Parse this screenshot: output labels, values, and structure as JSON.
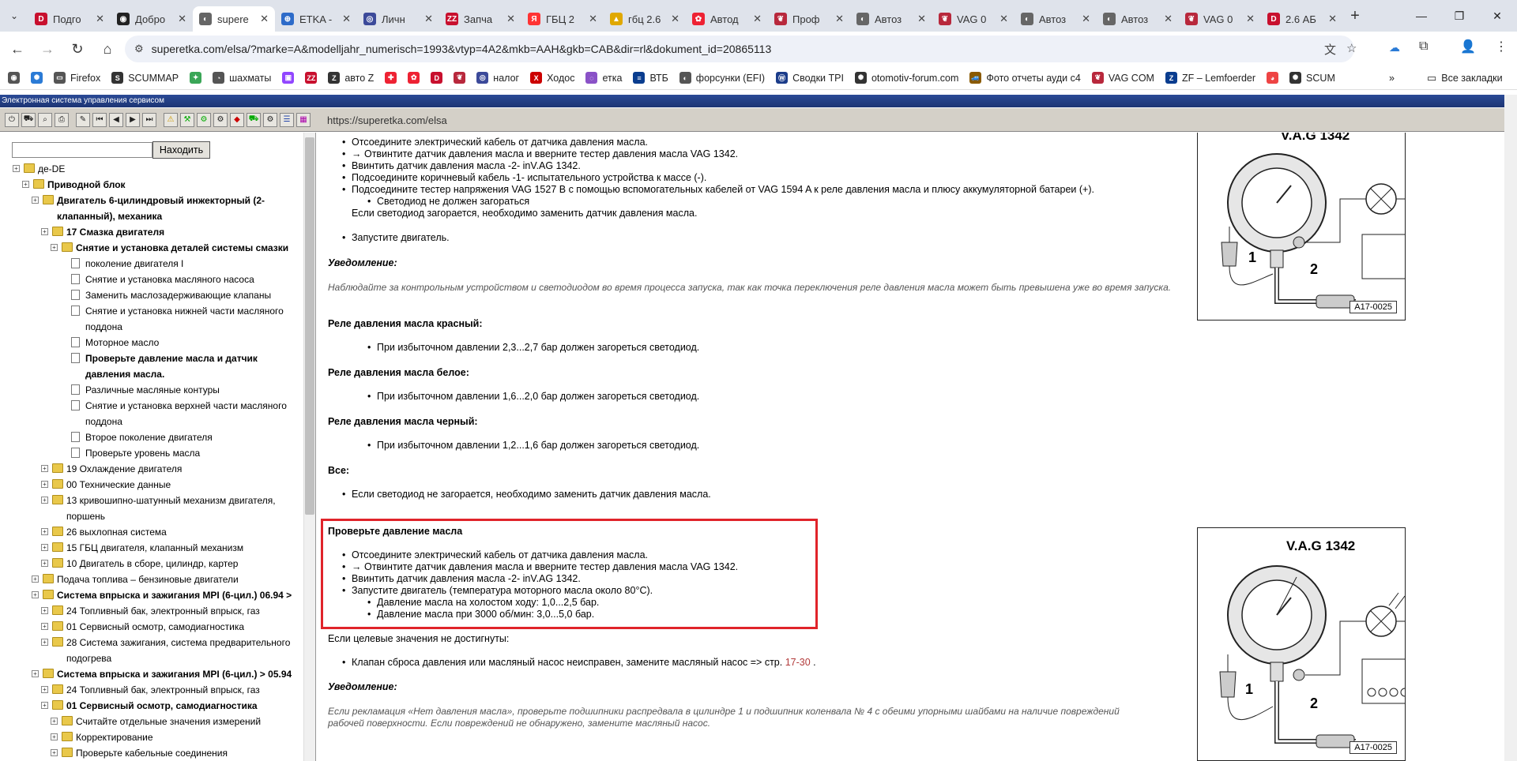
{
  "browser": {
    "tabs": [
      {
        "label": "Подго",
        "icon": "D",
        "color": "#c8102e"
      },
      {
        "label": "Добро",
        "icon": "◉",
        "color": "#222"
      },
      {
        "label": "supere",
        "icon": "◐",
        "color": "#666",
        "active": true
      },
      {
        "label": "ETKA -",
        "icon": "⊕",
        "color": "#2d6bc9"
      },
      {
        "label": "Личн",
        "icon": "◎",
        "color": "#3c4a9a"
      },
      {
        "label": "Запча",
        "icon": "ZZ",
        "color": "#c8102e"
      },
      {
        "label": "ГБЦ 2",
        "icon": "Я",
        "color": "#f33"
      },
      {
        "label": "гбц 2.6",
        "icon": "▲",
        "color": "#e0a800"
      },
      {
        "label": "Автод",
        "icon": "✿",
        "color": "#e23"
      },
      {
        "label": "Проф",
        "icon": "❦",
        "color": "#b8283c"
      },
      {
        "label": "Автоз",
        "icon": "◐",
        "color": "#666"
      },
      {
        "label": "VAG 0",
        "icon": "❦",
        "color": "#b8283c"
      },
      {
        "label": "Автоз",
        "icon": "◐",
        "color": "#666"
      },
      {
        "label": "Автоз",
        "icon": "◐",
        "color": "#666"
      },
      {
        "label": "VAG 0",
        "icon": "❦",
        "color": "#b8283c"
      },
      {
        "label": "2.6 АБ",
        "icon": "D",
        "color": "#c8102e"
      }
    ],
    "new_tab": "+",
    "url": "superetka.com/elsa/?marke=A&modelljahr_numerisch=1993&vtyp=4A2&mkb=AAH&gkb=CAB&dir=rl&dokument_id=20865113",
    "bookmarks": [
      {
        "label": "",
        "icon": "◉",
        "color": "#555"
      },
      {
        "label": "",
        "icon": "✺",
        "color": "#2b7bd6"
      },
      {
        "label": "Firefox",
        "icon": "▭",
        "color": "#555"
      },
      {
        "label": "SCUMMAP",
        "icon": "S",
        "color": "#333"
      },
      {
        "label": "",
        "icon": "✦",
        "color": "#3aa657"
      },
      {
        "label": "шахматы",
        "icon": "◔",
        "color": "#555"
      },
      {
        "label": "",
        "icon": "▣",
        "color": "#9146ff"
      },
      {
        "label": "",
        "icon": "ZZ",
        "color": "#c8102e"
      },
      {
        "label": "авто Z",
        "icon": "Z",
        "color": "#333"
      },
      {
        "label": "",
        "icon": "✚",
        "color": "#e23"
      },
      {
        "label": "",
        "icon": "✿",
        "color": "#e23"
      },
      {
        "label": "",
        "icon": "D",
        "color": "#c8102e"
      },
      {
        "label": "",
        "icon": "❦",
        "color": "#b8283c"
      },
      {
        "label": "налог",
        "icon": "◎",
        "color": "#3c4a9a"
      },
      {
        "label": "Ходос",
        "icon": "X",
        "color": "#c00"
      },
      {
        "label": "етка",
        "icon": "◌",
        "color": "#8a52c7"
      },
      {
        "label": "ВТБ",
        "icon": "≡",
        "color": "#0a3d8f"
      },
      {
        "label": "форсунки (EFI)",
        "icon": "◐",
        "color": "#555"
      },
      {
        "label": "Сводки TPI",
        "icon": "Ⓦ",
        "color": "#1b3c8a"
      },
      {
        "label": "otomotiv-forum.com",
        "icon": "✺",
        "color": "#333"
      },
      {
        "label": "Фото отчеты ауди с4",
        "icon": "🚙",
        "color": "#8a5a00"
      },
      {
        "label": "VAG COM",
        "icon": "❦",
        "color": "#b8283c"
      },
      {
        "label": "ZF – Lemfoerder",
        "icon": "Z",
        "color": "#0a3d8f"
      },
      {
        "label": "",
        "icon": "◕",
        "color": "#e44"
      },
      {
        "label": "SCUM",
        "icon": "✺",
        "color": "#333"
      }
    ],
    "bookmarks_overflow": "»",
    "all_bookmarks": "Все закладки"
  },
  "elsa": {
    "header": "Электронная система управления сервисом",
    "toolbar_url": "https://superetka.com/elsa",
    "search_placeholder": "",
    "find_button": "Находить"
  },
  "tree": [
    {
      "level": 0,
      "type": "folder",
      "label": "де-DE",
      "bold": false,
      "lines": 1
    },
    {
      "level": 1,
      "type": "folder",
      "label": "Приводной блок",
      "bold": true,
      "lines": 1
    },
    {
      "level": 2,
      "type": "folder",
      "label": "Двигатель 6-цилиндровый инжекторный (2-клапанный), механика",
      "bold": true,
      "lines": 2
    },
    {
      "level": 3,
      "type": "folder",
      "label": "17 Смазка двигателя",
      "bold": true,
      "lines": 1
    },
    {
      "level": 4,
      "type": "folder",
      "label": "Снятие и установка деталей системы смазки",
      "bold": true,
      "lines": 1
    },
    {
      "level": 5,
      "type": "doc",
      "label": "поколение двигателя I",
      "bold": false,
      "lines": 1
    },
    {
      "level": 5,
      "type": "doc",
      "label": "Снятие и установка масляного насоса",
      "bold": false,
      "lines": 1
    },
    {
      "level": 5,
      "type": "doc",
      "label": "Заменить маслозадерживающие клапаны",
      "bold": false,
      "lines": 1
    },
    {
      "level": 5,
      "type": "doc",
      "label": "Снятие и установка нижней части масляного поддона",
      "bold": false,
      "lines": 2
    },
    {
      "level": 5,
      "type": "doc",
      "label": "Моторное масло",
      "bold": false,
      "lines": 1
    },
    {
      "level": 5,
      "type": "doc",
      "label": "Проверьте давление масла и датчик давления масла.",
      "bold": true,
      "lines": 2
    },
    {
      "level": 5,
      "type": "doc",
      "label": "Различные масляные контуры",
      "bold": false,
      "lines": 1
    },
    {
      "level": 5,
      "type": "doc",
      "label": "Снятие и установка верхней части масляного поддона",
      "bold": false,
      "lines": 2
    },
    {
      "level": 5,
      "type": "doc",
      "label": "Второе поколение двигателя",
      "bold": false,
      "lines": 1
    },
    {
      "level": 5,
      "type": "doc",
      "label": "Проверьте уровень масла",
      "bold": false,
      "lines": 1
    },
    {
      "level": 3,
      "type": "folder",
      "label": "19 Охлаждение двигателя",
      "bold": false,
      "lines": 1
    },
    {
      "level": 3,
      "type": "folder",
      "label": "00 Технические данные",
      "bold": false,
      "lines": 1
    },
    {
      "level": 3,
      "type": "folder",
      "label": "13 кривошипно-шатунный механизм двигателя, поршень",
      "bold": false,
      "lines": 2
    },
    {
      "level": 3,
      "type": "folder",
      "label": "26 выхлопная система",
      "bold": false,
      "lines": 1
    },
    {
      "level": 3,
      "type": "folder",
      "label": "15 ГБЦ двигателя, клапанный механизм",
      "bold": false,
      "lines": 1
    },
    {
      "level": 3,
      "type": "folder",
      "label": "10 Двигатель в сборе, цилиндр, картер",
      "bold": false,
      "lines": 1
    },
    {
      "level": 2,
      "type": "folder",
      "label": "Подача топлива – бензиновые двигатели",
      "bold": false,
      "lines": 1
    },
    {
      "level": 2,
      "type": "folder",
      "label": "Система впрыска и зажигания MPI (6-цил.) 06.94 >",
      "bold": true,
      "lines": 1
    },
    {
      "level": 3,
      "type": "folder",
      "label": "24 Топливный бак, электронный впрыск, газ",
      "bold": false,
      "lines": 1
    },
    {
      "level": 3,
      "type": "folder",
      "label": "01 Сервисный осмотр, самодиагностика",
      "bold": false,
      "lines": 1
    },
    {
      "level": 3,
      "type": "folder",
      "label": "28 Система зажигания, система предварительного подогрева",
      "bold": false,
      "lines": 2
    },
    {
      "level": 2,
      "type": "folder",
      "label": "Система впрыска и зажигания MPI (6-цил.) > 05.94",
      "bold": true,
      "lines": 1
    },
    {
      "level": 3,
      "type": "folder",
      "label": "24 Топливный бак, электронный впрыск, газ",
      "bold": false,
      "lines": 1
    },
    {
      "level": 3,
      "type": "folder",
      "label": "01 Сервисный осмотр, самодиагностика",
      "bold": true,
      "lines": 1
    },
    {
      "level": 4,
      "type": "folder",
      "label": "Считайте отдельные значения измерений",
      "bold": false,
      "lines": 1
    },
    {
      "level": 4,
      "type": "folder",
      "label": "Корректирование",
      "bold": false,
      "lines": 1
    },
    {
      "level": 4,
      "type": "folder",
      "label": "Проверьте кабельные соединения",
      "bold": false,
      "lines": 1
    }
  ],
  "doc": {
    "top_bullets": [
      "Отсоедините электрический кабель от датчика давления масла.",
      "→ Отвинтите датчик давления масла и вверните тестер давления масла VAG 1342.",
      "Ввинтить датчик давления масла -2- inV.AG 1342.",
      "Подсоедините коричневый кабель -1- испытательного устройства к массе (-).",
      "Подсоедините тестер напряжения VAG 1527 B с помощью вспомогательных кабелей от VAG 1594 A к реле давления масла и плюсу аккумуляторной батареи (+)."
    ],
    "sub_led_off": "Светодиод не должен загораться",
    "if_led_on": "Если светодиод загорается, необходимо заменить датчик давления масла.",
    "start_engine": "Запустите двигатель.",
    "notice1_title": "Уведомление:",
    "notice1_text": "Наблюдайте за контрольным устройством и светодиодом во время процесса запуска, так как точка переключения реле давления масла может быть превышена уже во время запуска.",
    "red_title": "Реле давления масла красный:",
    "red_item": "При избыточном давлении 2,3...2,7 бар должен загореться светодиод.",
    "white_title": "Реле давления масла белое:",
    "white_item": "При избыточном давлении 1,6...2,0 бар должен загореться светодиод.",
    "black_title": "Реле давления масла черный:",
    "black_item": "При избыточном давлении 1,2...1,6 бар должен загореться светодиод.",
    "all_title": "Все:",
    "all_item": "Если светодиод не загорается, необходимо заменить датчик давления масла.",
    "check_title": "Проверьте давление масла",
    "check_bullets": [
      "Отсоедините электрический кабель от датчика давления масла.",
      "→ Отвинтите датчик давления масла и вверните тестер давления масла VAG 1342.",
      "Ввинтить датчик давления масла -2- inV.AG 1342.",
      "Запустите двигатель (температура моторного масла около 80°C)."
    ],
    "check_sub": [
      "Давление масла на холостом ходу: 1,0...2,5 бар.",
      "Давление масла при 3000 об/мин: 3,0...5,0 бар."
    ],
    "target_fail": "Если целевые значения не достигнуты:",
    "valve_item": "Клапан сброса давления или масляный насос неисправен, замените масляный насос => стр.",
    "valve_link": "17-30",
    "valve_tail": ".",
    "notice2_title": "Уведомление:",
    "notice2_text": "Если рекламация «Нет давления масла», проверьте подшипники распредвала в цилиндре 1 и подшипник коленвала № 4 с обеими упорными шайбами на наличие повреждений рабочей поверхности. Если повреждений не обнаружено, замените масляный насос."
  },
  "figures": [
    {
      "title": "V.A.G 1342",
      "label1": "1",
      "label2": "2",
      "id": "A17-0025"
    },
    {
      "title": "V.A.G 1342",
      "label1": "1",
      "label2": "2",
      "id": "A17-0025"
    }
  ]
}
